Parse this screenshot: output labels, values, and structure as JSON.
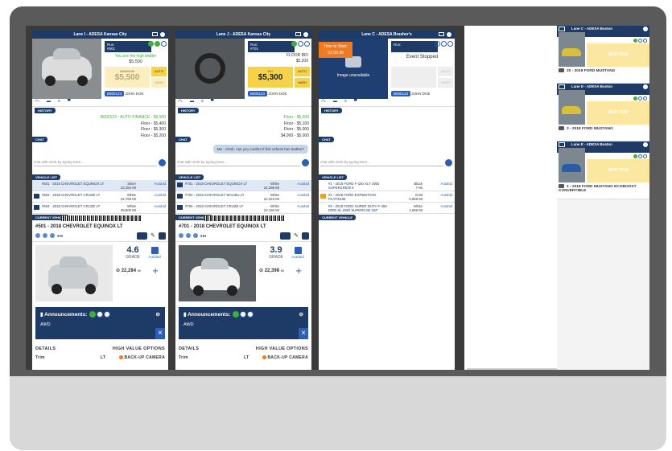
{
  "colors": {
    "navy": "#1d3b66",
    "blue": "#2b5fb5",
    "green": "#3fae3f",
    "gold": "#f5d24a",
    "orange": "#f07a22"
  },
  "lanes": [
    {
      "title": "Lane I - ADESA Kansas City",
      "run_label": "Run:",
      "run_num": "#501",
      "high_bidder": "You are the high bidder",
      "high_bid_value": "$5,500",
      "bid_small": "MINIMUM",
      "bid_amount": "$5,500",
      "auto": "AUTO",
      "hard": "HARD",
      "bidder_id": "B000123",
      "user": "JOHN DOE",
      "history": [
        "B000123 - AUTO FINANCE - $5,500",
        "Floor - $5,400",
        "Floor - $5,300",
        "Floor - $5,200"
      ],
      "chat_bubble": "",
      "chat_placeholder": "chat with clerk by typing here...",
      "vehicle_list": [
        {
          "desc": "#501 - 2018 CHEVROLET EQUINOX LT",
          "color": "Silver",
          "miles": "22,284 MI",
          "action": "Autobid"
        },
        {
          "desc": "#502 - 2018 CHEVROLET CRUZE LT",
          "color": "White",
          "miles": "24,769 MI",
          "action": "Autobid"
        },
        {
          "desc": "#504 - 2018 CHEVROLET CRUZE LT",
          "color": "White",
          "miles": "29,800 MI",
          "action": "Autobid"
        }
      ],
      "cv_title": "#501 - 2018 CHEVROLET EQUINOX LT",
      "grade": "4.6",
      "grade_label": "GRADE",
      "miles": "22,284",
      "miles_unit": "MI",
      "autobid": "Autobid",
      "announcements": "Announcements:",
      "ann_msg": "AWD",
      "details": "DETAILS",
      "hvo": "HIGH VALUE OPTIONS",
      "trim_label": "Trim",
      "trim_value": "LT",
      "hvo_item": "BACK-UP CAMERA"
    },
    {
      "title": "Lane J - ADESA Kansas City",
      "run_label": "Run:",
      "run_num": "#701",
      "floor_label": "FLOOR BID",
      "floor_value": "$5,200",
      "bid_small": "BID",
      "bid_amount": "$5,300",
      "auto": "AUTO",
      "hard": "HARD",
      "bidder_id": "B000123",
      "user": "JOHN DOE",
      "history": [
        "Floor - $5,200",
        "Floor - $5,100",
        "Floor - $5,000",
        "$4,900 - $5,000"
      ],
      "chat_bubble": "Me - Clerk- can you confirm if this vehicle has leather?",
      "chat_placeholder": "chat with clerk by typing here...",
      "vehicle_list": [
        {
          "desc": "#701 - 2018 CHEVROLET EQUINOX LT",
          "color": "White",
          "miles": "22,398 MI",
          "action": "Autobid"
        },
        {
          "desc": "#704 - 2018 CHEVROLET MALIBU LT",
          "color": "White",
          "miles": "22,323 MI",
          "action": "Autobid"
        },
        {
          "desc": "#706 - 2018 CHEVROLET CRUZE LT",
          "color": "White",
          "miles": "22,192 MI",
          "action": "Autobid"
        }
      ],
      "cv_title": "#701 - 2018 CHEVROLET EQUINOX LT",
      "grade": "3.9",
      "grade_label": "GRADE",
      "miles": "22,398",
      "miles_unit": "MI",
      "autobid": "Autobid",
      "announcements": "Announcements:",
      "ann_msg": "AWD",
      "details": "DETAILS",
      "hvo": "HIGH VALUE OPTIONS",
      "trim_label": "Trim",
      "trim_value": "LT",
      "hvo_item": "BACK-UP CAMERA"
    },
    {
      "title": "Lane C - ADESA Brasher's",
      "time_label": "Time to Start:",
      "time_value": "01:50:39",
      "run_label": "Run:",
      "event_status": "Event Stopped",
      "image_unavailable": "Image unavailable",
      "auto": "AUTO",
      "hard": "HARD",
      "bidder_id": "B000123",
      "user": "JOHN DOE",
      "chat_placeholder": "chat with clerk by typing here...",
      "vehicle_list": [
        {
          "desc": "#1 - 2018 FORD F-150 XLT 4WD SUPERCREW 5",
          "color": "Black",
          "miles": "7 MI",
          "action": "Autobid"
        },
        {
          "desc": "#2 - 2018 FORD EXPEDITION PLATINUM",
          "color": "Gold",
          "miles": "5,559 MI",
          "action": "Autobid"
        },
        {
          "desc": "#3 - 2018 FORD SUPER DUTY F-450 DRW XL 2WD SUPERCAB 162\"",
          "color": "White",
          "miles": "1,666 MI",
          "action": "Autobid"
        }
      ]
    }
  ],
  "labels": {
    "history": "HISTORY",
    "chat": "CHAT",
    "vehicle_list": "VEHICLE LIST",
    "current_vehicle": "CURRENT VEHICLE"
  },
  "side_lanes": [
    {
      "title": "Lane C - ADESA Boston",
      "badge": "NEW ITEM",
      "vehicle": "20 - 2018 FORD MUSTANG"
    },
    {
      "title": "Lane D - ADESA Boston",
      "badge": "NEW ITEM",
      "vehicle": "3 - 2018 FORD MUSTANG"
    },
    {
      "title": "Lane E - ADESA Boston",
      "badge": "NEW ITEM",
      "vehicle": "1 - 2018 FORD MUSTANG ECOBOOST CONVERTIBLE"
    }
  ]
}
